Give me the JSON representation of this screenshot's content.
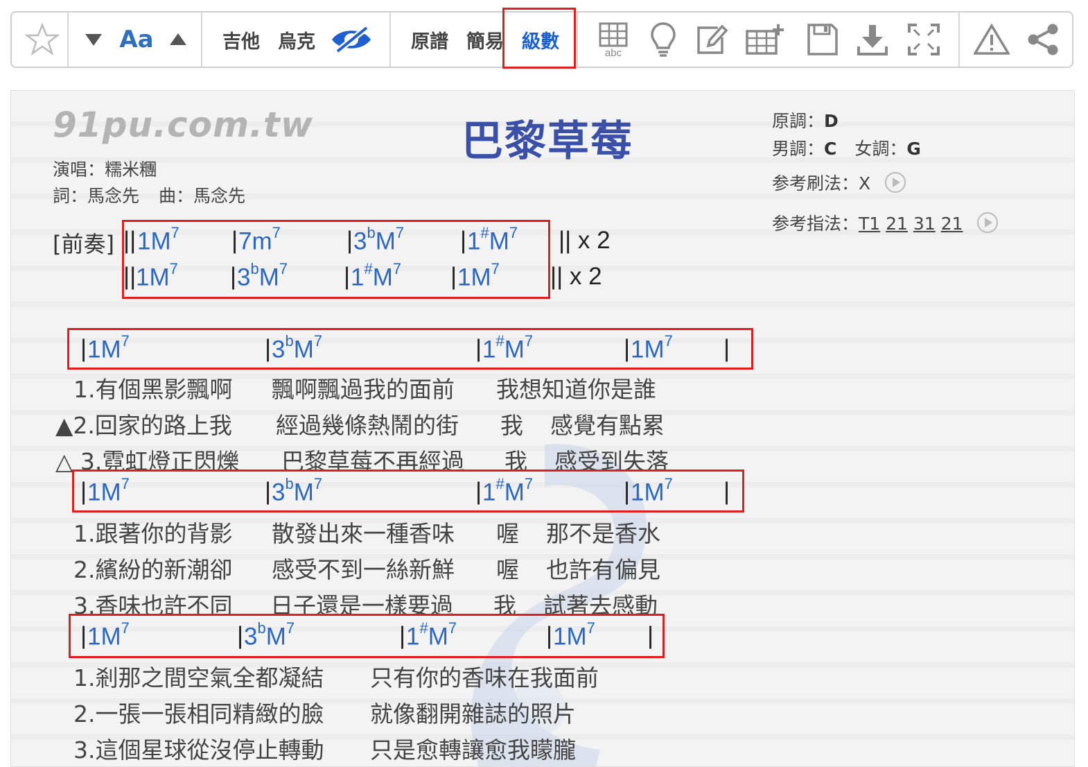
{
  "toolbar": {
    "star_icon": "star-icon",
    "font_label": "Aa",
    "instruments": [
      "吉他",
      "烏克"
    ],
    "notation": [
      "原譜",
      "簡易",
      "級數"
    ],
    "active_notation": "級數",
    "colors": {
      "accent": "#2f6fbd",
      "highlight": "#e01e1e"
    }
  },
  "song": {
    "site": "91pu.com.tw",
    "title": "巴黎草莓",
    "singer_label": "演唱：",
    "singer": "糯米糰",
    "lyricist_label": "詞：",
    "lyricist": "馬念先",
    "composer_label": "曲：",
    "composer": "馬念先",
    "orig_key_label": "原調：",
    "orig_key": "D",
    "male_key_label": "男調：",
    "male_key": "C",
    "female_key_label": "女調：",
    "female_key": "G",
    "strum_label": "参考刷法：",
    "strum": "X",
    "pick_label": "参考指法：",
    "pick": [
      "T1",
      "21",
      "31",
      "21"
    ]
  },
  "intro": {
    "label": "[前奏]",
    "repeat1": "|| x 2",
    "repeat2": "|| x 2"
  },
  "chords": {
    "c1M7": "1M",
    "c7m7": "7m",
    "c3bM7": "3",
    "c1sM7": "1",
    "sup7": "7",
    "supb": "b",
    "sups": "#",
    "M": "M"
  },
  "verse": {
    "a1": "1.有個黑影飄啊",
    "a2": "飄啊飄過我的面前",
    "a3": "我想知道你是誰",
    "b1": "▲2.回家的路上我",
    "b2": "經過幾條熱鬧的街",
    "b3": "我",
    "b4": "感覺有點累",
    "c1": "△ 3.霓虹燈正閃爍",
    "c2": "巴黎草莓不再經過",
    "c3": "我",
    "c4": "感受到失落",
    "d1": "1.跟著你的背影",
    "d2": "散發出來一種香味",
    "d3": "喔",
    "d4": "那不是香水",
    "e1": "2.繽紛的新潮卻",
    "e2": "感受不到一絲新鮮",
    "e3": "喔",
    "e4": "也許有偏見",
    "f1": "3.香味也許不同",
    "f2": "日子還是一樣要過",
    "f3": "我",
    "f4": "試著去感動",
    "g1": "1.剎那之間空氣全都凝結",
    "g2": "只有你的香味在我面前",
    "h1": "2.一張一張相同精緻的臉",
    "h2": "就像翻開雜誌的照片",
    "i1": "3.這個星球從沒停止轉動",
    "i2": "只是愈轉讓愈我矇朧"
  }
}
